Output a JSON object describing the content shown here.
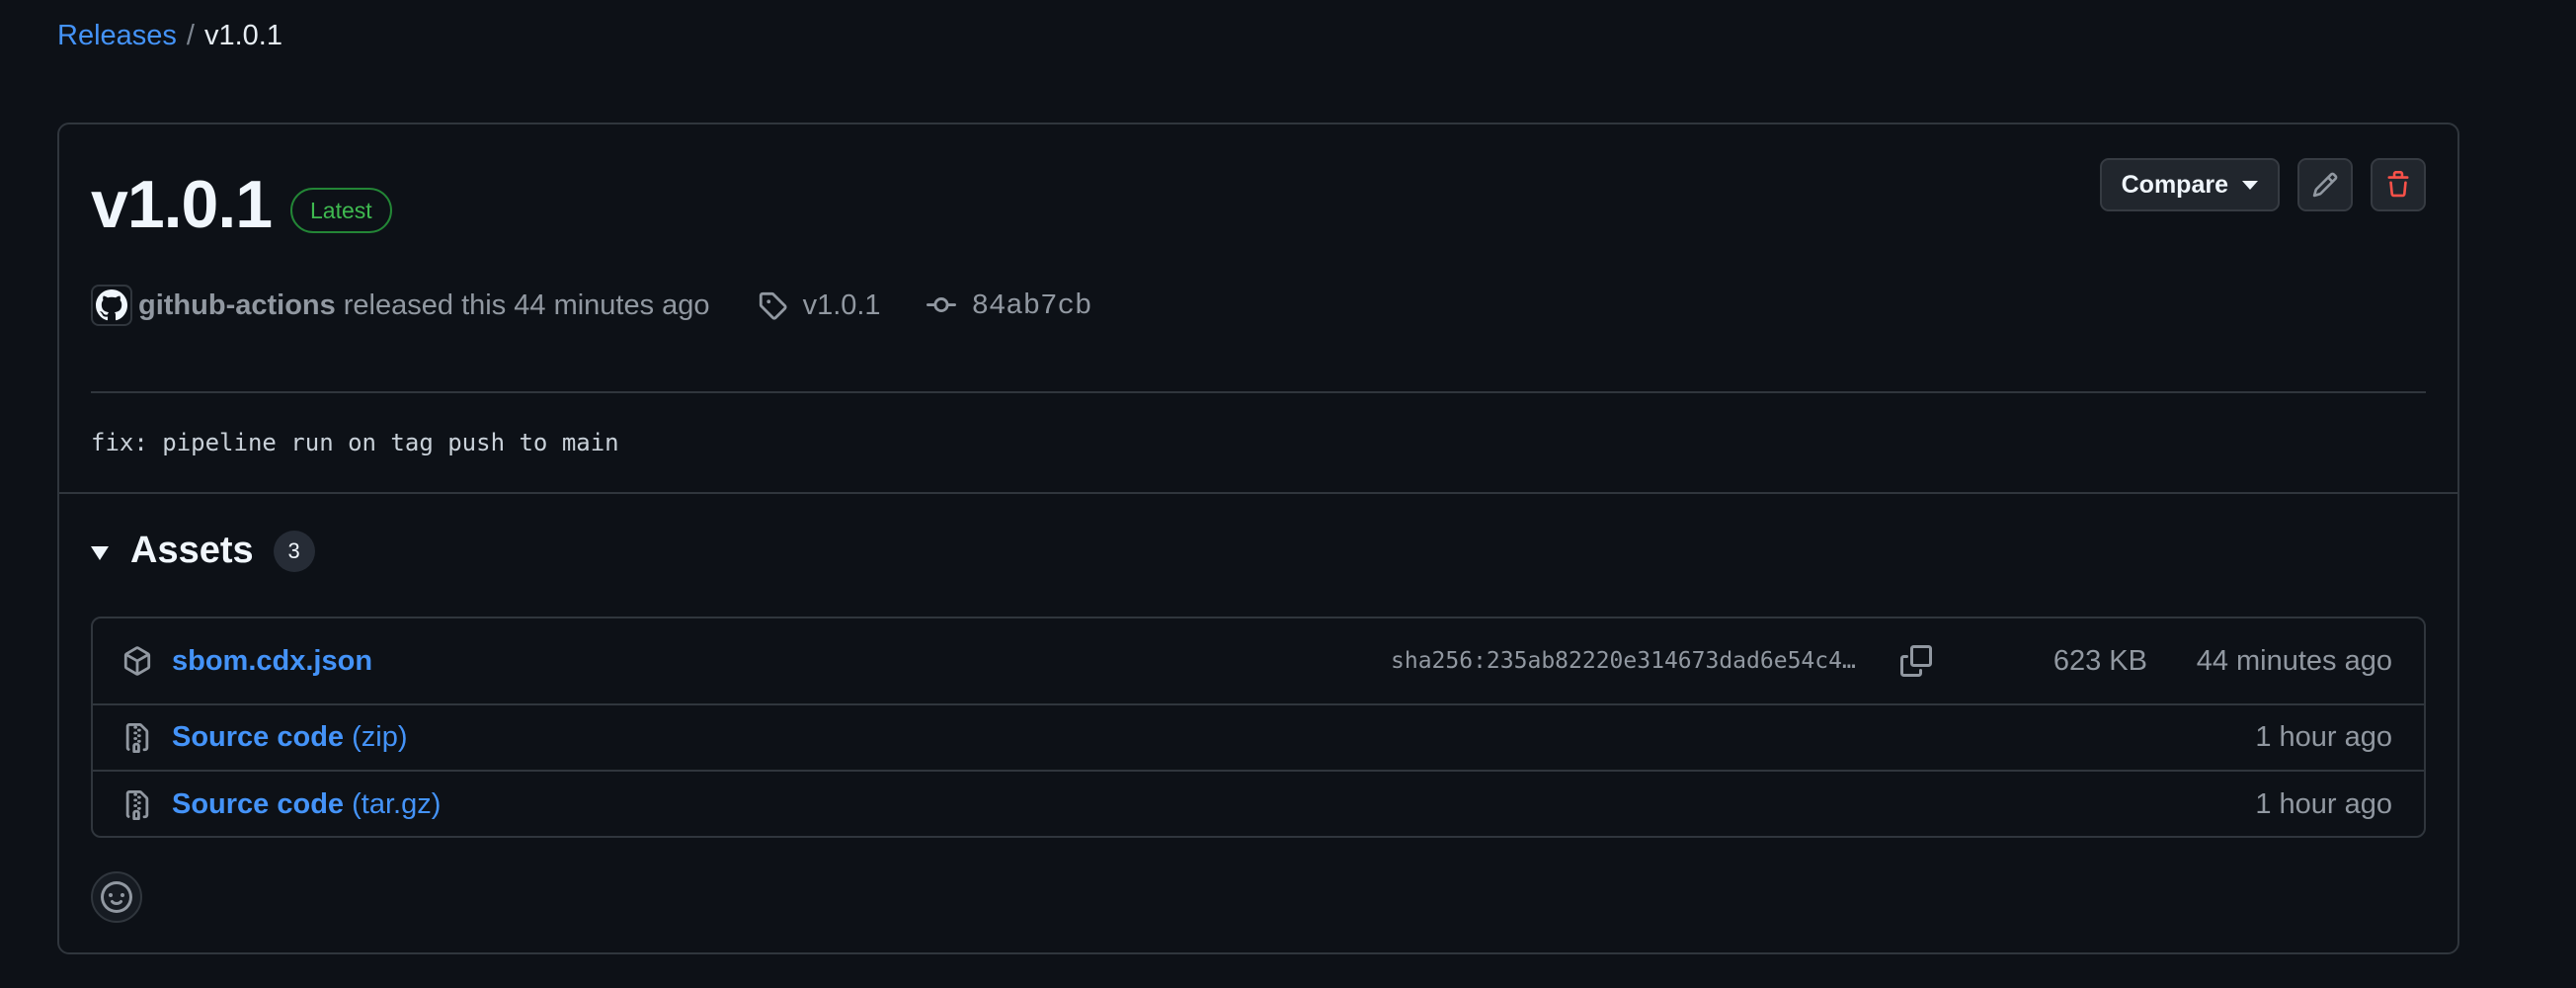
{
  "breadcrumb": {
    "parent": "Releases",
    "separator": "/",
    "current": "v1.0.1"
  },
  "release": {
    "title": "v1.0.1",
    "badge": "Latest",
    "author": "github-actions",
    "released_text": "released this 44 minutes ago",
    "tag": "v1.0.1",
    "commit": "84ab7cb",
    "notes": "fix: pipeline run on tag push to main"
  },
  "actions": {
    "compare_label": "Compare",
    "edit_icon": "pencil-icon",
    "delete_icon": "trash-icon"
  },
  "assets": {
    "title": "Assets",
    "count": "3",
    "items": [
      {
        "name": "sbom.cdx.json",
        "ext": "",
        "sha": "sha256:235ab82220e314673dad6e54c4…",
        "size": "623 KB",
        "time": "44 minutes ago",
        "icon": "package-icon"
      },
      {
        "name": "Source code",
        "ext": "(zip)",
        "sha": "",
        "size": "",
        "time": "1 hour ago",
        "icon": "file-zip-icon"
      },
      {
        "name": "Source code",
        "ext": "(tar.gz)",
        "sha": "",
        "size": "",
        "time": "1 hour ago",
        "icon": "file-zip-icon"
      }
    ]
  },
  "colors": {
    "background": "#0d1117",
    "link": "#4493f8",
    "border": "#30363d",
    "success": "#3fb950",
    "danger": "#f85149"
  }
}
